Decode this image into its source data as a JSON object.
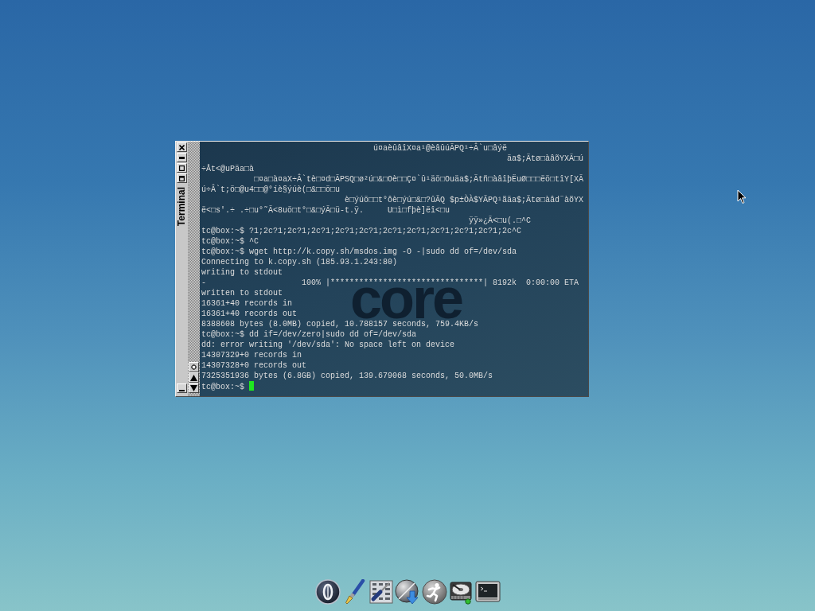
{
  "window": {
    "title": "Terminal"
  },
  "terminal": {
    "background_logo": "core",
    "lines": [
      "                                    ú¤aèûâîX¤a¹@èâûúÃPQ¹÷Â`u□âýë",
      "                                                                äa$;Ätø□àâõYXÃ□ú",
      "÷Åt<@uPäa□à",
      "           □¤a□à¤aX÷Â`tè□¤d□ÃPSQ□ø²ú□&□Oè□□Ç¤`û¹äö□Ouäa$;Ätñ□àâîþËuØ□□□ëö□tîY[XÃ",
      "ú÷Â`t;ö□@u4□□@°íè§ýúè(□&□□ö□u",
      "                              è□ýúö□□t°ôè□ýú□&□?ûÃQ $p±ÒÀ$YÃPQ¹ãäa$;Ätø□àâd¨àõYX",
      "ë<□s'.÷ .÷□u°˜Ã<8uö□t°□&□ýÃ□ü-t.ÿ.     U□ì□fþè]ëî<□u",
      "                                                        ÿÿ»¿Ã<□u(.□^C",
      "tc@box:~$ ?1;2c?1;2c?1;2c?1;2c?1;2c?1;2c?1;2c?1;2c?1;2c?1;2c?1;2c^C",
      "tc@box:~$ ^C",
      "tc@box:~$ wget http://k.copy.sh/msdos.img -O -|sudo dd of=/dev/sda",
      "Connecting to k.copy.sh (185.93.1.243:80)",
      "writing to stdout",
      "-                    100% |********************************| 8192k  0:00:00 ETA",
      "written to stdout",
      "16361+40 records in",
      "16361+40 records out",
      "8388608 bytes (8.0MB) copied, 10.788157 seconds, 759.4KB/s",
      "tc@box:~$ dd if=/dev/zero|sudo dd of=/dev/sda",
      "dd: error writing '/dev/sda': No space left on device",
      "14307329+0 records in",
      "14307328+0 records out",
      "7325351936 bytes (6.8GB) copied, 139.679068 seconds, 50.0MB/s",
      "tc@box:~$"
    ]
  }
}
